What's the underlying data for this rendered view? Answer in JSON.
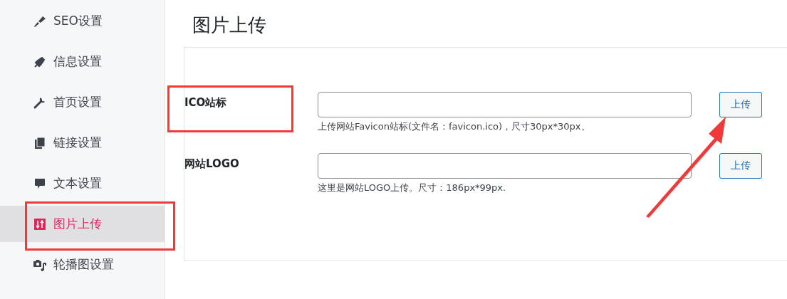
{
  "sidebar": {
    "items": [
      {
        "label": "SEO设置",
        "selected": false
      },
      {
        "label": "信息设置",
        "selected": false
      },
      {
        "label": "首页设置",
        "selected": false
      },
      {
        "label": "链接设置",
        "selected": false
      },
      {
        "label": "文本设置",
        "selected": false
      },
      {
        "label": "图片上传",
        "selected": true
      },
      {
        "label": "轮播图设置",
        "selected": false
      }
    ]
  },
  "page": {
    "title": "图片上传"
  },
  "fields": [
    {
      "label": "ICO站标",
      "help": "上传网站Favicon站标(文件名：favicon.ico)，尺寸30px*30px。",
      "button": "上传"
    },
    {
      "label": "网站LOGO",
      "help": "这里是网站LOGO上传。尺寸：186px*99px.",
      "button": "上传"
    }
  ]
}
